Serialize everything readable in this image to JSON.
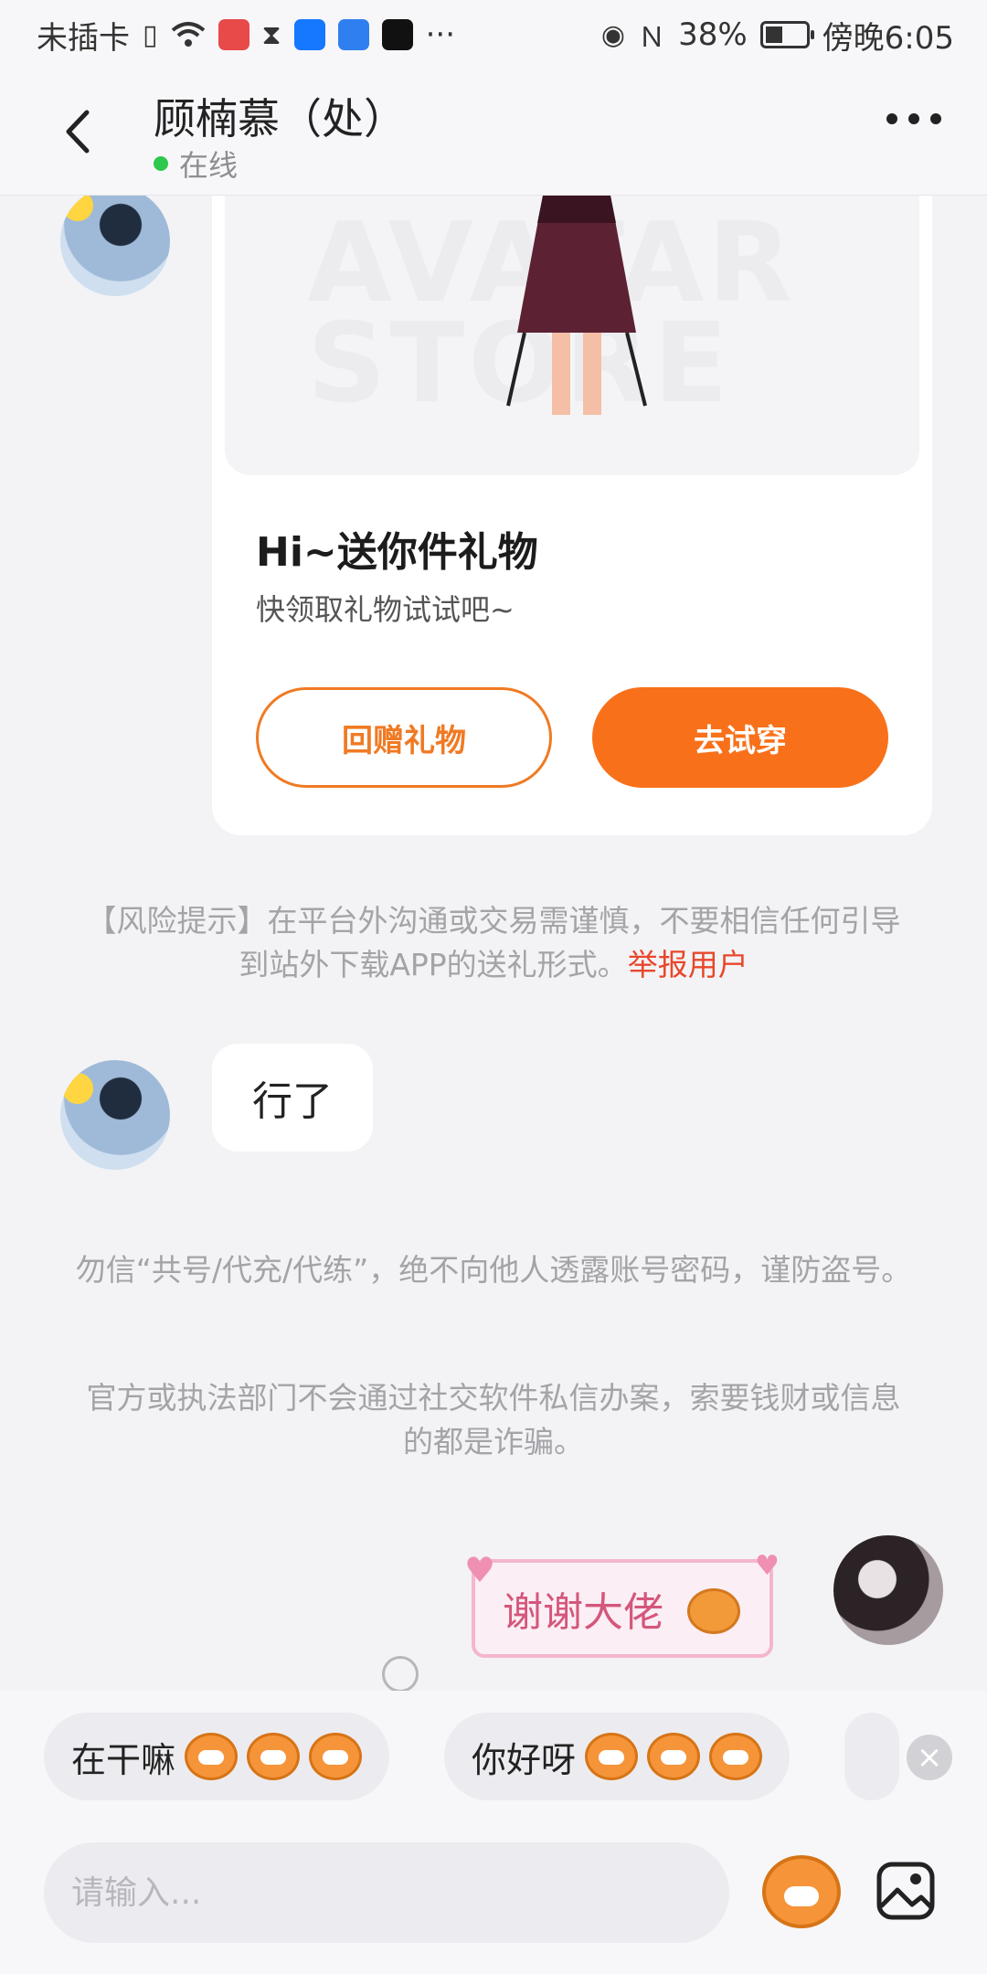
{
  "status_bar": {
    "left_text": "未插卡",
    "app_icons": [
      "huawei-store-icon",
      "alipay-icon",
      "lightbulb-icon",
      "tiktok-icon"
    ],
    "more": "···",
    "battery": "38%",
    "time": "傍晚6:05"
  },
  "header": {
    "title": "顾楠慕（处）",
    "presence": "在线"
  },
  "gift_card": {
    "watermark": "AVATAR STORE",
    "title": "Hi~送你件礼物",
    "subtitle": "快领取礼物试试吧~",
    "return_gift_button": "回赠礼物",
    "try_on_button": "去试穿"
  },
  "risk_notice": {
    "text": "【风险提示】在平台外沟通或交易需谨慎，不要相信任何引导到站外下载APP的送礼形式。",
    "report_link": "举报用户"
  },
  "message_peer": "行了",
  "safety_notice_1": "勿信“共号/代充/代练”，绝不向他人透露账号密码，谨防盗号。",
  "safety_notice_2": "官方或执法部门不会通过社交软件私信办案，索要钱财或信息的都是诈骗。",
  "sticker_self": "谢谢大佬",
  "quick_replies": [
    {
      "text": "在干嘛"
    },
    {
      "text": "你好呀"
    }
  ],
  "input": {
    "placeholder": "请输入..."
  },
  "colors": {
    "accent": "#f8711a",
    "online": "#2dc84d",
    "report": "#e8472b"
  }
}
